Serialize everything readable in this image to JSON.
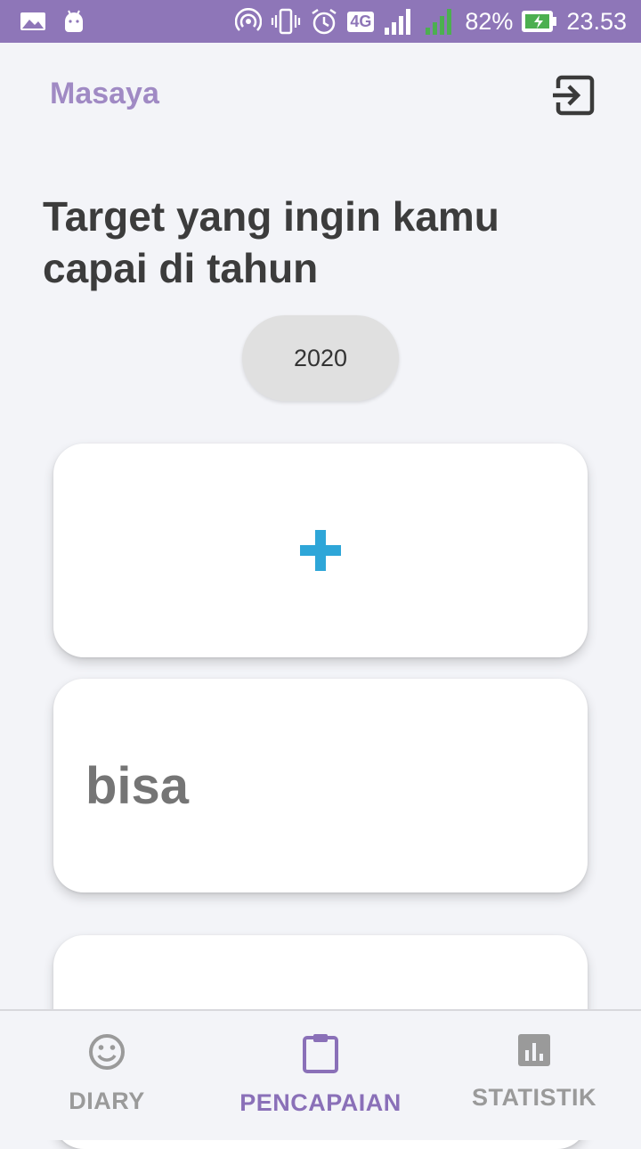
{
  "status_bar": {
    "battery_percent": "82%",
    "time": "23.53",
    "network": "4G",
    "sim1": "1",
    "sim2": "2"
  },
  "app_bar": {
    "title": "Masaya",
    "logout_icon": "exit-to-app-icon"
  },
  "headline": "Target yang ingin kamu capai di tahun",
  "year_selector": {
    "value": "2020"
  },
  "cards": {
    "add_icon": "plus-icon",
    "goals": [
      {
        "text": "bisa"
      }
    ]
  },
  "bottom_nav": {
    "items": [
      {
        "label": "DIARY",
        "icon": "smiley-icon",
        "active": false
      },
      {
        "label": "PENCAPAIAN",
        "icon": "clipboard-icon",
        "active": true
      },
      {
        "label": "STATISTIK",
        "icon": "bar-chart-icon",
        "active": false
      }
    ]
  },
  "colors": {
    "status_bar": "#8e76b8",
    "accent": "#8a70b8",
    "plus": "#2ea6d8",
    "background": "#f3f4f8"
  }
}
